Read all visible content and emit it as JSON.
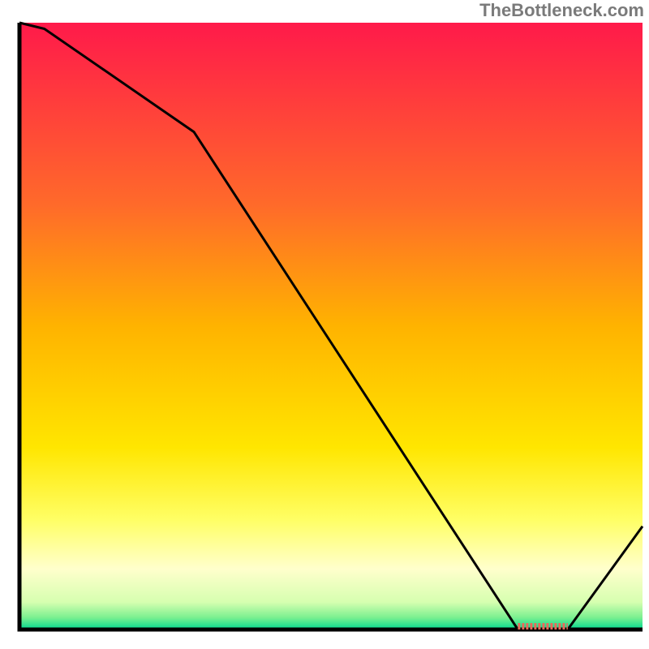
{
  "attribution": "TheBottleneck.com",
  "chart_data": {
    "type": "line",
    "title": "",
    "xlabel": "",
    "ylabel": "",
    "xlim": [
      0,
      100
    ],
    "ylim": [
      0,
      100
    ],
    "x": [
      0,
      4,
      28,
      80,
      88,
      100
    ],
    "values": [
      100,
      99,
      82,
      0,
      0,
      17
    ],
    "marker_range_x": [
      80,
      88
    ],
    "gradient_stops": [
      {
        "offset": 0.0,
        "color": "#ff1a4a"
      },
      {
        "offset": 0.3,
        "color": "#ff6a2a"
      },
      {
        "offset": 0.5,
        "color": "#ffb300"
      },
      {
        "offset": 0.7,
        "color": "#ffe600"
      },
      {
        "offset": 0.82,
        "color": "#ffff66"
      },
      {
        "offset": 0.9,
        "color": "#ffffcc"
      },
      {
        "offset": 0.955,
        "color": "#d6ffb0"
      },
      {
        "offset": 0.98,
        "color": "#7cf090"
      },
      {
        "offset": 1.0,
        "color": "#00d890"
      }
    ]
  }
}
